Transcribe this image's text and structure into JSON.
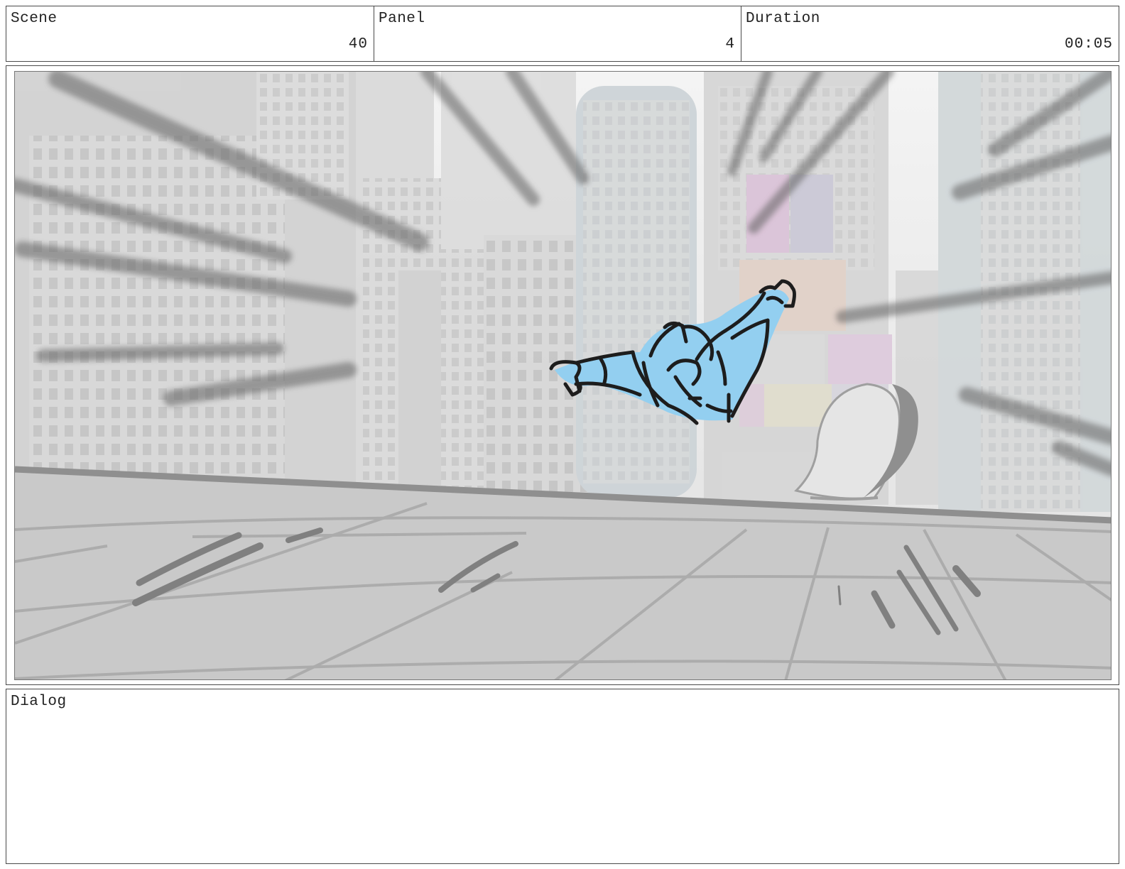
{
  "header": {
    "scene_label": "Scene",
    "scene_value": "40",
    "panel_label": "Panel",
    "panel_value": "4",
    "duration_label": "Duration",
    "duration_value": "00:05"
  },
  "dialog": {
    "label": "Dialog",
    "text": ""
  },
  "colors": {
    "character_fill": "#8ecdf0",
    "sketch_line": "#111111",
    "background_gray": "#cfcfcf"
  }
}
